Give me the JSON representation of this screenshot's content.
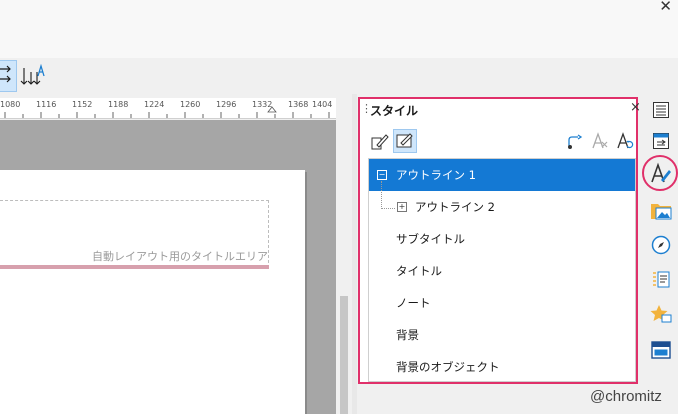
{
  "window": {
    "close_glyph": "✕"
  },
  "ruler": {
    "labels": [
      "1080",
      "1116",
      "1152",
      "1188",
      "1224",
      "1260",
      "1296",
      "1332",
      "1368",
      "1404"
    ]
  },
  "slide": {
    "placeholder_text": "自動レイアウト用のタイトルエリア"
  },
  "styles_panel": {
    "title": "スタイル",
    "close_glyph": "×",
    "items": [
      {
        "label": "アウトライン 1",
        "selected": true,
        "expander": "−"
      },
      {
        "label": "アウトライン 2",
        "selected": false,
        "expander": "+"
      },
      {
        "label": "サブタイトル",
        "selected": false
      },
      {
        "label": "タイトル",
        "selected": false
      },
      {
        "label": "ノート",
        "selected": false
      },
      {
        "label": "背景",
        "selected": false
      },
      {
        "label": "背景のオブジェクト",
        "selected": false
      }
    ]
  },
  "sidebar_deck": {
    "items": [
      "properties-icon",
      "slide-transition-icon",
      "styles-icon",
      "gallery-icon",
      "navigator-icon",
      "animation-icon",
      "master-slides-icon",
      "slide-layout-icon"
    ]
  },
  "colors": {
    "accent_highlight": "#e0306a",
    "selection": "#1479d4"
  },
  "watermark": "@chromitz"
}
